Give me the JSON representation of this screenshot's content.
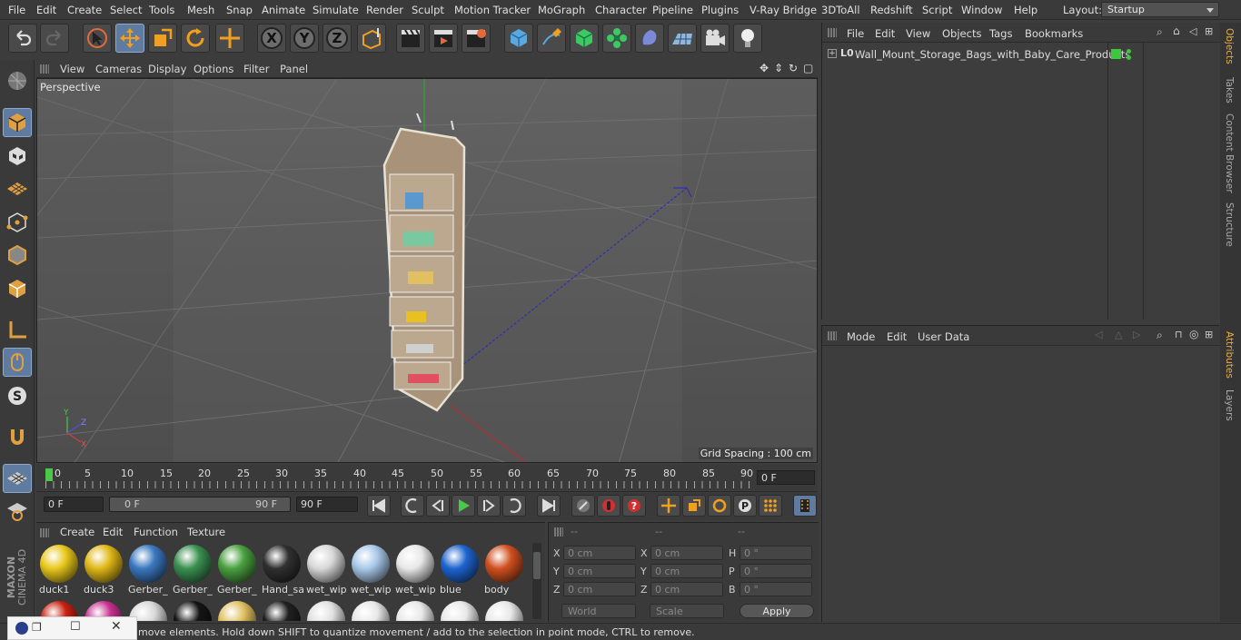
{
  "menubar": {
    "items": [
      "File",
      "Edit",
      "Create",
      "Select",
      "Tools",
      "Mesh",
      "Snap",
      "Animate",
      "Simulate",
      "Render",
      "Sculpt",
      "Motion Tracker",
      "MoGraph",
      "Character",
      "Pipeline",
      "Plugins",
      "V-Ray Bridge",
      "3DToAll",
      "Redshift",
      "Script",
      "Window",
      "Help"
    ],
    "layout_label": "Layout:",
    "layout_value": "Startup"
  },
  "viewport": {
    "menu": [
      "View",
      "Cameras",
      "Display",
      "Options",
      "Filter",
      "Panel"
    ],
    "label": "Perspective",
    "grid_spacing": "Grid Spacing : 100 cm"
  },
  "timeline": {
    "ticks": [
      "0",
      "5",
      "10",
      "15",
      "20",
      "25",
      "30",
      "35",
      "40",
      "45",
      "50",
      "55",
      "60",
      "65",
      "70",
      "75",
      "80",
      "85",
      "90"
    ],
    "current_frame": "0 F"
  },
  "transport": {
    "start_field": "0 F",
    "range_start": "0 F",
    "range_end": "90 F",
    "end_field": "90 F"
  },
  "materials": {
    "menu": [
      "Create",
      "Edit",
      "Function",
      "Texture"
    ],
    "row1": [
      {
        "name": "duck1",
        "color": "#e8c81c"
      },
      {
        "name": "duck3",
        "color": "#e0b818"
      },
      {
        "name": "Gerber_",
        "color": "#3a78c0"
      },
      {
        "name": "Gerber_",
        "color": "#3a9050"
      },
      {
        "name": "Gerber_",
        "color": "#4aa040"
      },
      {
        "name": "Hand_sa",
        "color": "#303030"
      },
      {
        "name": "wet_wip",
        "color": "#d8d8d8"
      },
      {
        "name": "wet_wip",
        "color": "#a8c8e8"
      },
      {
        "name": "wet_wip",
        "color": "#e8e8e8"
      },
      {
        "name": "blue",
        "color": "#1e64d0"
      },
      {
        "name": "body",
        "color": "#d05020"
      }
    ],
    "row2_colors": [
      "#c82010",
      "#c83090",
      "#d8d8d8",
      "#151515",
      "#e0c060",
      "#202020",
      "#e0e0e0",
      "#e8e8e8",
      "#e8e8e8",
      "#e8e8e8",
      "#e8e8e8"
    ]
  },
  "coords": {
    "headers": [
      "--",
      "--",
      "--"
    ],
    "rows": [
      {
        "a": "X",
        "av": "0 cm",
        "b": "X",
        "bv": "0 cm",
        "c": "H",
        "cv": "0 °"
      },
      {
        "a": "Y",
        "av": "0 cm",
        "b": "Y",
        "bv": "0 cm",
        "c": "P",
        "cv": "0 °"
      },
      {
        "a": "Z",
        "av": "0 cm",
        "b": "Z",
        "bv": "0 cm",
        "c": "B",
        "cv": "0 °"
      }
    ],
    "space": "World",
    "mode": "Scale",
    "apply": "Apply"
  },
  "objects": {
    "menu": [
      "File",
      "Edit",
      "View",
      "Objects",
      "Tags",
      "Bookmarks"
    ],
    "items": [
      {
        "name": "Wall_Mount_Storage_Bags_with_Baby_Care_Products"
      }
    ]
  },
  "attributes": {
    "menu": [
      "Mode",
      "Edit",
      "User Data"
    ]
  },
  "right_tabs": [
    "Objects",
    "Takes",
    "Content Browser",
    "Structure",
    "Attributes",
    "Layers"
  ],
  "status": {
    "text": "move elements. Hold down SHIFT to quantize movement / add to the selection in point mode, CTRL to remove."
  },
  "brand": {
    "line1": "MAXON",
    "line2": "CINEMA 4D"
  },
  "colors": {
    "accent": "#5f7ba0",
    "tab_active": "#e8b048",
    "green": "#3cc83c"
  }
}
